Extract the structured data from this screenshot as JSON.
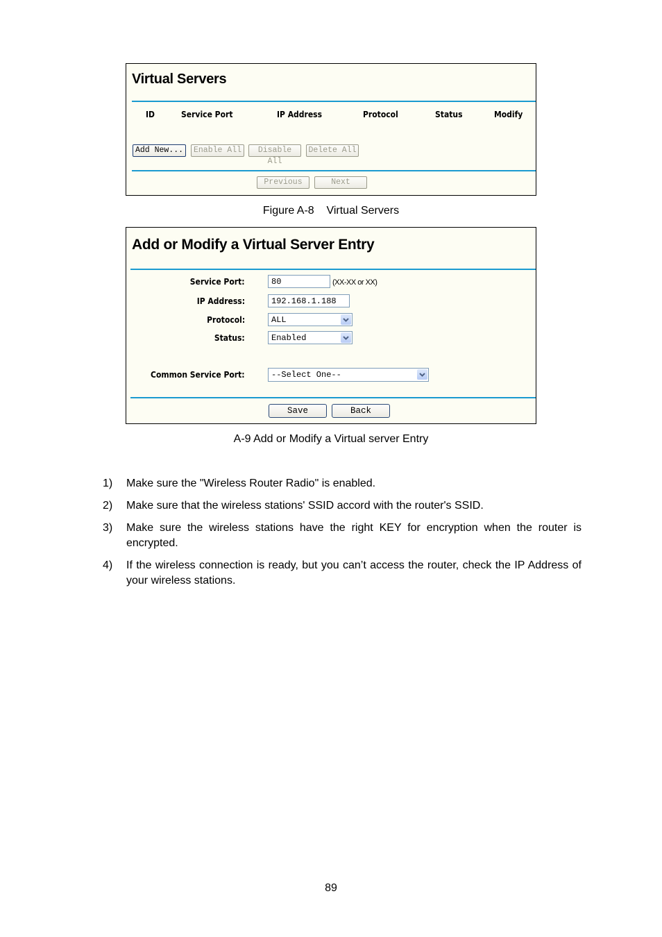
{
  "figure_a8": {
    "title": "Virtual Servers",
    "columns": [
      "ID",
      "Service Port",
      "IP Address",
      "Protocol",
      "Status",
      "Modify"
    ],
    "buttons": {
      "add_new": "Add New...",
      "enable_all": "Enable All",
      "disable_all": "Disable All",
      "delete_all": "Delete All",
      "previous": "Previous",
      "next": "Next"
    },
    "caption": "Figure A-8    Virtual Servers"
  },
  "figure_a9": {
    "title": "Add or Modify a Virtual Server Entry",
    "fields": {
      "service_port": {
        "label": "Service Port:",
        "value": "80",
        "hint": "(XX-XX or XX)"
      },
      "ip_address": {
        "label": "IP Address:",
        "value": "192.168.1.188"
      },
      "protocol": {
        "label": "Protocol:",
        "value": "ALL"
      },
      "status": {
        "label": "Status:",
        "value": "Enabled"
      },
      "common_service_port": {
        "label": "Common Service Port:",
        "value": "--Select One--"
      }
    },
    "buttons": {
      "save": "Save",
      "back": "Back"
    },
    "caption": "A-9 Add or Modify a Virtual server Entry"
  },
  "steps": [
    {
      "num": "1)",
      "text": "Make sure the \"Wireless Router Radio\" is enabled."
    },
    {
      "num": "2)",
      "text": "Make sure that the wireless stations' SSID accord with the router's SSID."
    },
    {
      "num": "3)",
      "text": "Make sure the wireless stations have the right KEY for encryption when the router is encrypted."
    },
    {
      "num": "4)",
      "text": "If the wireless connection is ready, but you can’t access the router, check the IP Address of your wireless stations."
    }
  ],
  "page_number": "89",
  "colors": {
    "panel_bg": "#fdfdf3",
    "rule": "#1a9ad0",
    "field_border": "#7f9db9"
  }
}
